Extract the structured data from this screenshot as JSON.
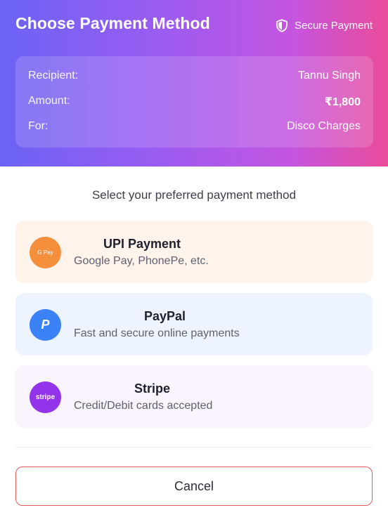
{
  "header": {
    "title": "Choose Payment Method",
    "secure_label": "Secure Payment"
  },
  "summary": {
    "recipient_label": "Recipient:",
    "recipient_value": "Tannu Singh",
    "amount_label": "Amount:",
    "amount_value": "₹1,800",
    "for_label": "For:",
    "for_value": "Disco Charges"
  },
  "prompt": "Select your preferred payment method",
  "options": [
    {
      "title": "UPI Payment",
      "subtitle": "Google Pay, PhonePe, etc.",
      "icon_text": "G Pay",
      "icon": "gpay-icon",
      "color": "#f58f3c"
    },
    {
      "title": "PayPal",
      "subtitle": "Fast and secure online payments",
      "icon_text": "P",
      "icon": "paypal-icon",
      "color": "#3b82f6"
    },
    {
      "title": "Stripe",
      "subtitle": "Credit/Debit cards accepted",
      "icon_text": "stripe",
      "icon": "stripe-icon",
      "color": "#9333ea"
    }
  ],
  "cancel_label": "Cancel",
  "colors": {
    "gradient_start": "#6b63f4",
    "gradient_end": "#ea4c9a",
    "cancel_border": "#e05a5a"
  }
}
